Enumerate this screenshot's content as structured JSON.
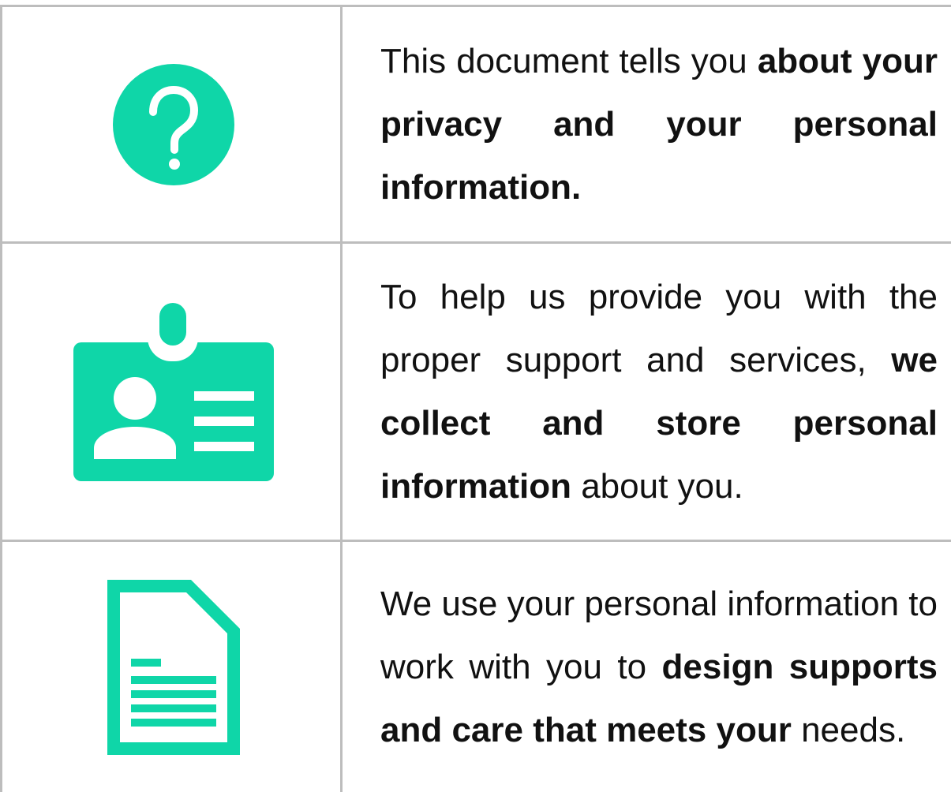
{
  "accent_color": "#0fd6a8",
  "rows": [
    {
      "icon": "question-mark-circle-icon",
      "segments": [
        {
          "text": "This document tells you ",
          "bold": false
        },
        {
          "text": "about your privacy and your personal information.",
          "bold": true
        }
      ]
    },
    {
      "icon": "id-badge-icon",
      "segments": [
        {
          "text": "To help us provide you with the proper support and services, ",
          "bold": false
        },
        {
          "text": "we collect and store personal information",
          "bold": true
        },
        {
          "text": " about you.",
          "bold": false
        }
      ]
    },
    {
      "icon": "document-icon",
      "segments": [
        {
          "text": "We use your personal information to work with you to ",
          "bold": false
        },
        {
          "text": "design supports and care that meets your",
          "bold": true
        },
        {
          "text": " needs.",
          "bold": false
        }
      ]
    }
  ]
}
